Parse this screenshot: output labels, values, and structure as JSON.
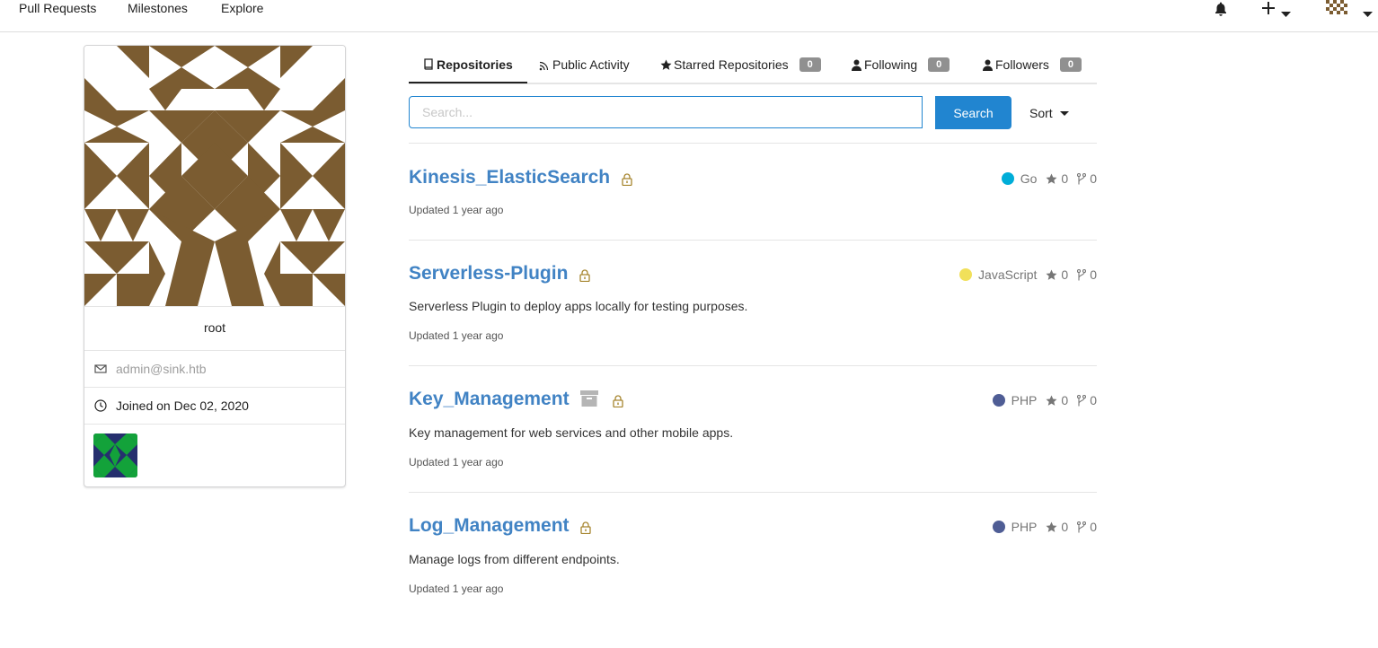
{
  "nav": {
    "links": [
      "Pull Requests",
      "Milestones",
      "Explore"
    ]
  },
  "profile": {
    "username": "root",
    "email": "admin@sink.htb",
    "joined": "Joined on Dec 02, 2020"
  },
  "tabs": [
    {
      "label": "Repositories",
      "count": null
    },
    {
      "label": "Public Activity",
      "count": null
    },
    {
      "label": "Starred Repositories",
      "count": "0"
    },
    {
      "label": "Following",
      "count": "0"
    },
    {
      "label": "Followers",
      "count": "0"
    }
  ],
  "search": {
    "placeholder": "Search...",
    "button_label": "Search",
    "sort_label": "Sort"
  },
  "repos": [
    {
      "name": "Kinesis_ElasticSearch",
      "description": "",
      "updated": "Updated 1 year ago",
      "language": "Go",
      "language_color": "#00add8",
      "stars": "0",
      "forks": "0",
      "archived": false
    },
    {
      "name": "Serverless-Plugin",
      "description": "Serverless Plugin to deploy apps locally for testing purposes.",
      "updated": "Updated 1 year ago",
      "language": "JavaScript",
      "language_color": "#f1e05a",
      "stars": "0",
      "forks": "0",
      "archived": false
    },
    {
      "name": "Key_Management",
      "description": "Key management for web services and other mobile apps.",
      "updated": "Updated 1 year ago",
      "language": "PHP",
      "language_color": "#4f5d95",
      "stars": "0",
      "forks": "0",
      "archived": true
    },
    {
      "name": "Log_Management",
      "description": "Manage logs from different endpoints.",
      "updated": "Updated 1 year ago",
      "language": "PHP",
      "language_color": "#4f5d95",
      "stars": "0",
      "forks": "0",
      "archived": false
    }
  ],
  "colors": {
    "accent": "#2185d0",
    "link": "#4183c4",
    "avatar_brown": "#7b5c31",
    "org_green": "#13a23a",
    "org_navy": "#252f6e",
    "lock": "#a6852e",
    "badge": "#909090"
  },
  "icons": [
    "bell-icon",
    "plus-icon",
    "caret-down-icon",
    "user-avatar-icon",
    "mail-icon",
    "clock-icon",
    "book-icon",
    "rss-icon",
    "star-icon",
    "person-icon",
    "lock-icon",
    "archive-icon",
    "fork-icon"
  ]
}
